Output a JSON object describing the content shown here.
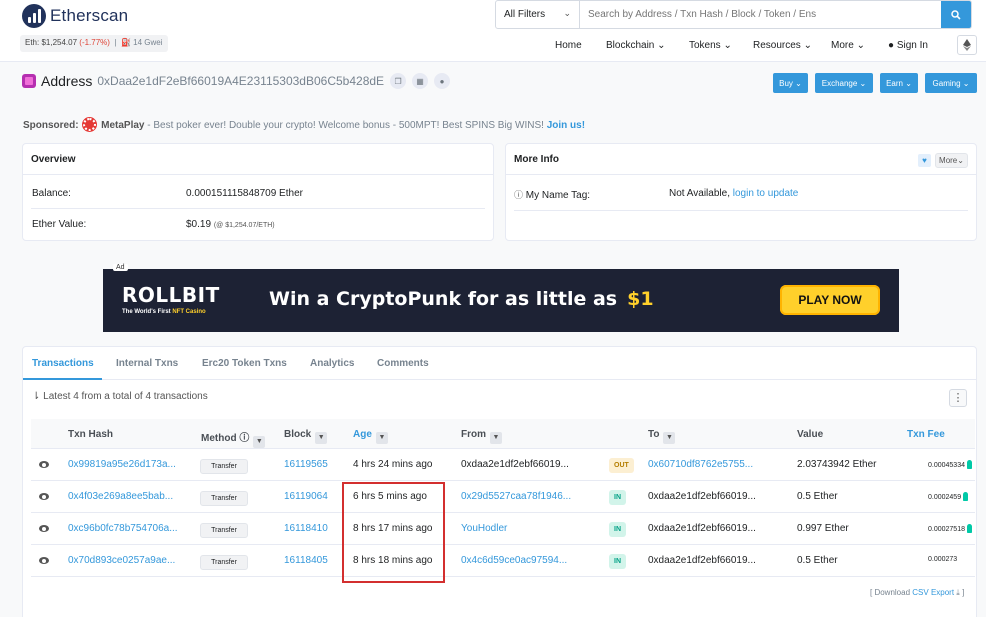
{
  "header": {
    "logo_text": "Etherscan",
    "eth_price_label": "Eth: $1,254.07",
    "eth_change": "(-1.77%)",
    "gas": "14 Gwei",
    "filter_label": "All Filters",
    "search_placeholder": "Search by Address / Txn Hash / Block / Token / Ens",
    "nav": {
      "home": "Home",
      "blockchain": "Blockchain",
      "tokens": "Tokens",
      "resources": "Resources",
      "more": "More",
      "signin": "Sign In"
    }
  },
  "address": {
    "label": "Address",
    "hash": "0xDaa2e1dF2eBf66019A4E23115303dB06C5b428dE",
    "buttons": {
      "buy": "Buy",
      "exchange": "Exchange",
      "earn": "Earn",
      "gaming": "Gaming"
    }
  },
  "sponsored": {
    "label": "Sponsored:",
    "name": "MetaPlay",
    "text": "- Best poker ever! Double your crypto! Welcome bonus - 500MPT! Best SPINS Big WINS!",
    "cta": "Join us!"
  },
  "overview": {
    "title": "Overview",
    "balance_label": "Balance:",
    "balance_value": "0.000151115848709 Ether",
    "value_label": "Ether Value:",
    "value_amount": "$0.19",
    "value_rate": "(@ $1,254.07/ETH)"
  },
  "more_info": {
    "title": "More Info",
    "more_btn": "More",
    "name_tag_label": "My Name Tag:",
    "name_tag_value": "Not Available,",
    "name_tag_link": "login to update"
  },
  "ad": {
    "tag": "Ad",
    "brand": "ROLLBIT",
    "sub": "The World's First",
    "sub_accent": "NFT Casino",
    "headline": "Win a CryptoPunk for as little as",
    "price": "$1",
    "cta": "PLAY NOW"
  },
  "tabs": [
    "Transactions",
    "Internal Txns",
    "Erc20 Token Txns",
    "Analytics",
    "Comments"
  ],
  "summary": "Latest 4 from a total of 4 transactions",
  "columns": {
    "hash": "Txn Hash",
    "method": "Method",
    "block": "Block",
    "age": "Age",
    "from": "From",
    "to": "To",
    "value": "Value",
    "fee": "Txn Fee"
  },
  "rows": [
    {
      "hash": "0x99819a95e26d173a...",
      "method": "Transfer",
      "block": "16119565",
      "age": "4 hrs 24 mins ago",
      "from": "0xdaa2e1df2ebf66019...",
      "dir": "OUT",
      "to": "0x60710df8762e5755...",
      "value": "2.03743942 Ether",
      "fee": "0.00045334"
    },
    {
      "hash": "0x4f03e269a8ee5bab...",
      "method": "Transfer",
      "block": "16119064",
      "age": "6 hrs 5 mins ago",
      "from": "0x29d5527caa78f1946...",
      "dir": "IN",
      "to": "0xdaa2e1df2ebf66019...",
      "value": "0.5 Ether",
      "fee": "0.0002459"
    },
    {
      "hash": "0xc96b0fc78b754706a...",
      "method": "Transfer",
      "block": "16118410",
      "age": "8 hrs 17 mins ago",
      "from": "YouHodler",
      "dir": "IN",
      "to": "0xdaa2e1df2ebf66019...",
      "value": "0.997 Ether",
      "fee": "0.00027518"
    },
    {
      "hash": "0x70d893ce0257a9ae...",
      "method": "Transfer",
      "block": "16118405",
      "age": "8 hrs 18 mins ago",
      "from": "0x4c6d59ce0ac97594...",
      "dir": "IN",
      "to": "0xdaa2e1df2ebf66019...",
      "value": "0.5 Ether",
      "fee": "0.000273"
    }
  ],
  "download": {
    "prefix": "[ Download",
    "link": "CSV Export",
    "suffix": "]"
  },
  "colors": {
    "accent": "#3498db",
    "brand": "#21325b",
    "highlight": "#d32f2f"
  }
}
